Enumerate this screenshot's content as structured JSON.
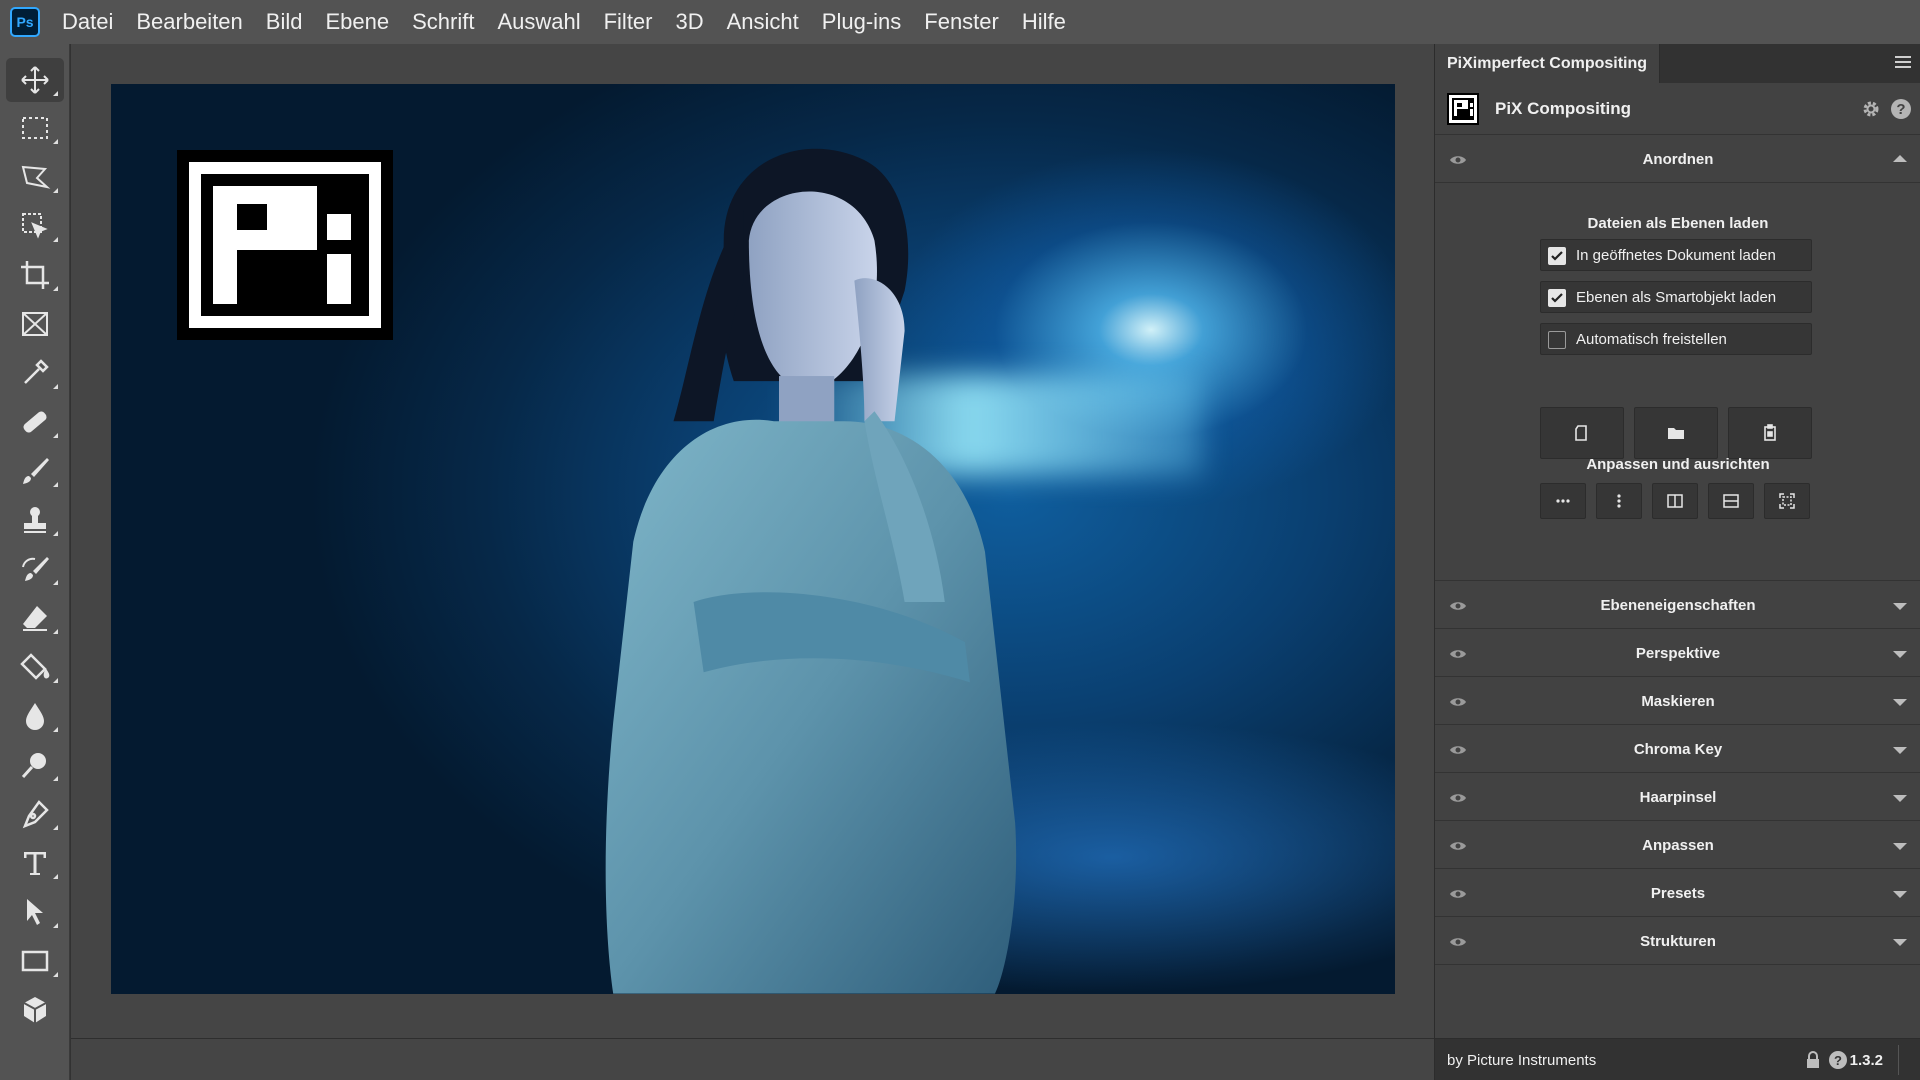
{
  "app": {
    "logo_text": "Ps"
  },
  "menu": [
    "Datei",
    "Bearbeiten",
    "Bild",
    "Ebene",
    "Schrift",
    "Auswahl",
    "Filter",
    "3D",
    "Ansicht",
    "Plug-ins",
    "Fenster",
    "Hilfe"
  ],
  "tools": [
    {
      "name": "move-tool",
      "icon": "move-icon",
      "active": true
    },
    {
      "name": "marquee-tool",
      "icon": "rectangle-marquee-icon"
    },
    {
      "name": "lasso-tool",
      "icon": "polygonal-lasso-icon"
    },
    {
      "name": "object-selection-tool",
      "icon": "object-selection-icon"
    },
    {
      "name": "crop-tool",
      "icon": "crop-icon"
    },
    {
      "name": "frame-tool",
      "icon": "frame-icon"
    },
    {
      "name": "eyedropper-tool",
      "icon": "eyedropper-icon"
    },
    {
      "name": "healing-tool",
      "icon": "bandage-icon"
    },
    {
      "name": "brush-tool",
      "icon": "brush-icon"
    },
    {
      "name": "stamp-tool",
      "icon": "stamp-icon"
    },
    {
      "name": "history-brush-tool",
      "icon": "history-brush-icon"
    },
    {
      "name": "eraser-tool",
      "icon": "eraser-icon"
    },
    {
      "name": "paint-bucket-tool",
      "icon": "paint-bucket-icon"
    },
    {
      "name": "blur-tool",
      "icon": "drop-icon"
    },
    {
      "name": "dodge-tool",
      "icon": "dodge-icon"
    },
    {
      "name": "pen-tool",
      "icon": "pen-icon"
    },
    {
      "name": "type-tool",
      "icon": "type-icon"
    },
    {
      "name": "path-selection-tool",
      "icon": "arrow-icon"
    },
    {
      "name": "shape-tool",
      "icon": "rectangle-icon"
    },
    {
      "name": "3d-tool",
      "icon": "cube-icon"
    }
  ],
  "panel": {
    "tab_label": "PiXimperfect Compositing",
    "plugin_title": "PiX Compositing",
    "sections": {
      "anordnen": "Anordnen",
      "load_heading": "Dateien als Ebenen laden",
      "checkboxes": [
        {
          "label": "In geöffnetes Dokument laden",
          "checked": true
        },
        {
          "label": "Ebenen als Smartobjekt laden",
          "checked": true
        },
        {
          "label": "Automatisch freistellen",
          "checked": false
        }
      ],
      "fit_heading": "Anpassen und ausrichten",
      "collapsed": [
        "Ebeneneigenschaften",
        "Perspektive",
        "Maskieren",
        "Chroma Key",
        "Haarpinsel",
        "Anpassen",
        "Presets",
        "Strukturen"
      ]
    },
    "footer": {
      "credit": "by Picture Instruments",
      "version": "1.3.2",
      "help": "?"
    },
    "help_glyph": "?"
  },
  "colors": {
    "accent": "#31a8ff",
    "panel_bg": "#424242",
    "toolbar_bg": "#535353"
  }
}
